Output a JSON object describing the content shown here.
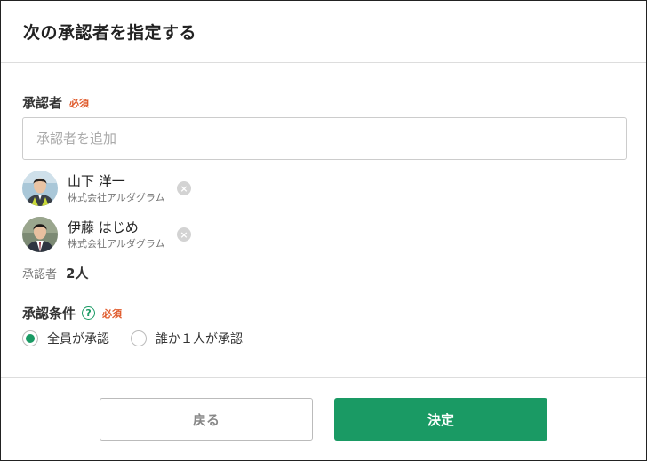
{
  "modal": {
    "title": "次の承認者を指定する"
  },
  "approvers_section": {
    "label": "承認者",
    "required": "必須",
    "input_placeholder": "承認者を追加",
    "input_value": "",
    "approvers": [
      {
        "name": "山下 洋一",
        "company": "株式会社アルダグラム",
        "remove_icon": "×"
      },
      {
        "name": "伊藤 はじめ",
        "company": "株式会社アルダグラム",
        "remove_icon": "×"
      }
    ],
    "count_label": "承認者",
    "count_value": "2人"
  },
  "condition_section": {
    "label": "承認条件",
    "help_icon": "?",
    "required": "必須",
    "options": [
      {
        "label": "全員が承認",
        "selected": true
      },
      {
        "label": "誰か１人が承認",
        "selected": false
      }
    ]
  },
  "footer": {
    "back_label": "戻る",
    "confirm_label": "決定"
  },
  "colors": {
    "accent": "#1a9a64",
    "required": "#e05a2b",
    "border": "#cccccc"
  },
  "icons": {
    "remove": "close-circle-icon",
    "help": "question-circle-icon"
  }
}
